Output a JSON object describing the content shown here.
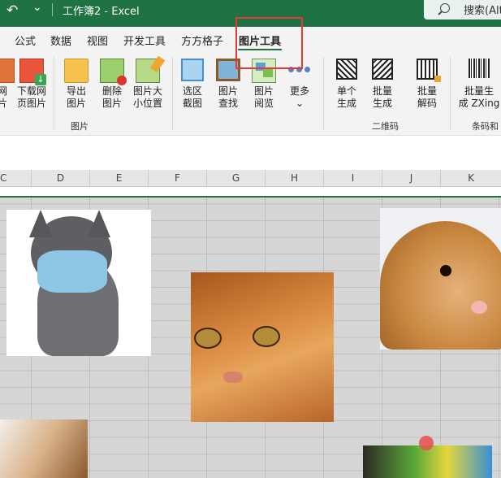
{
  "titlebar": {
    "undo_glyph": "↶",
    "dropdown_glyph": "⌄",
    "doc_title": "工作簿2  -  Excel",
    "search_label": "搜索(Alt"
  },
  "tabs": [
    "公式",
    "数据",
    "视图",
    "开发工具",
    "方方格子",
    "图片工具"
  ],
  "ribbon": {
    "buttons": {
      "cut_partial": [
        "网",
        "片"
      ],
      "download": [
        "下载网",
        "页图片"
      ],
      "export": [
        "导出",
        "图片"
      ],
      "delete": [
        "删除",
        "图片"
      ],
      "resize": [
        "图片大",
        "小位置"
      ],
      "select_shot": [
        "选区",
        "截图"
      ],
      "find": [
        "图片",
        "查找"
      ],
      "browse": [
        "图片",
        "阅览"
      ],
      "more": [
        "更多",
        "⌄"
      ],
      "qr_single": [
        "单个",
        "生成"
      ],
      "qr_batch": [
        "批量",
        "生成"
      ],
      "qr_decode": [
        "批量",
        "解码"
      ],
      "barcode": [
        "批量生",
        "成 ZXing"
      ]
    },
    "groups": {
      "picture": "图片",
      "qrcode": "二维码",
      "barcode": "条码和"
    }
  },
  "columns": [
    "C",
    "D",
    "E",
    "F",
    "G",
    "H",
    "I",
    "J",
    "K"
  ],
  "highlight_color": "#e53935",
  "accent_color": "#1f7244"
}
